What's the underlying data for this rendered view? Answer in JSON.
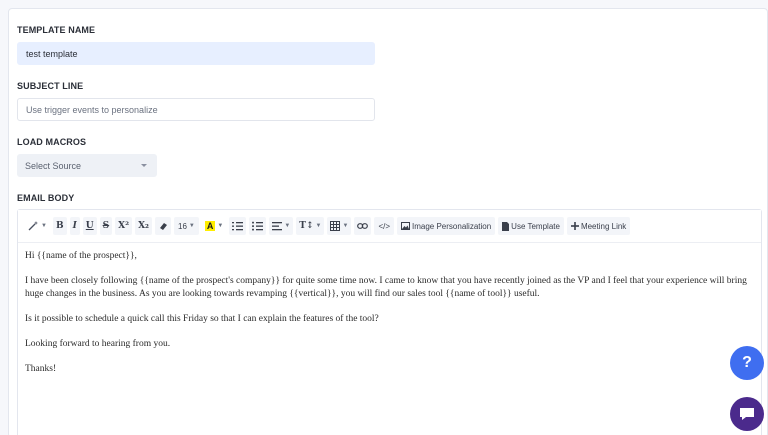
{
  "form": {
    "template_name_label": "TEMPLATE NAME",
    "template_name_value": "test template",
    "subject_line_label": "SUBJECT LINE",
    "subject_line_placeholder": "Use trigger events to personalize",
    "load_macros_label": "LOAD MACROS",
    "load_macros_selected": "Select Source",
    "email_body_label": "EMAIL BODY"
  },
  "toolbar": {
    "bold": "B",
    "italic": "I",
    "underline": "U",
    "strikethrough": "S",
    "superscript": "X²",
    "subscript": "X₂",
    "font_size": "16",
    "highlight": "A",
    "text_size": "T↕",
    "code": "</>",
    "image_personalization": "Image Personalization",
    "use_template": "Use Template",
    "meeting_link": "Meeting Link"
  },
  "body": {
    "greeting": "Hi {{name of the prospect}},",
    "paragraph1": "I have been closely following {{name of the prospect's company}} for quite some time now. I came to know that you have recently joined as the VP and I feel that your experience will bring huge changes in the business. As you are looking towards revamping {{vertical}}, you will find our sales tool {{name of tool}} useful.",
    "paragraph2": "Is it possible to schedule a quick call this Friday so that I can explain the features of the tool?",
    "paragraph3": "Looking forward to hearing from you.",
    "signoff": "Thanks!"
  },
  "fab": {
    "help": "?"
  },
  "colors": {
    "accent": "#3f6ef0",
    "chat": "#4b2a8c",
    "highlight": "#ffee00"
  }
}
